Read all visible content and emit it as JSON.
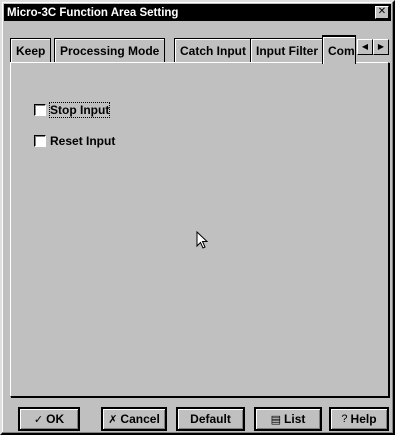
{
  "window": {
    "title": "Micro-3C Function Area Setting",
    "close_glyph": "✕"
  },
  "tabs": [
    {
      "label": "Keep",
      "active": false
    },
    {
      "label": "Processing Mode",
      "active": false
    },
    {
      "label": "Catch Input",
      "active": false
    },
    {
      "label": "Input Filter",
      "active": false
    },
    {
      "label": "Comm",
      "active": true
    }
  ],
  "tab_scroll": {
    "left_glyph": "◀",
    "right_glyph": "▶"
  },
  "options": [
    {
      "label": "Stop Input",
      "checked": false,
      "focused": true
    },
    {
      "label": "Reset Input",
      "checked": false,
      "focused": false
    }
  ],
  "buttons": {
    "ok": {
      "label": "OK",
      "icon": "✓"
    },
    "cancel": {
      "label": "Cancel",
      "icon": "✗"
    },
    "default": {
      "label": "Default"
    },
    "list": {
      "label": "List",
      "icon": "▤"
    },
    "help": {
      "label": "Help",
      "icon": "?"
    }
  },
  "colors": {
    "face": "#c0c0c0",
    "title_bar": "#000000",
    "title_text": "#ffffff"
  }
}
